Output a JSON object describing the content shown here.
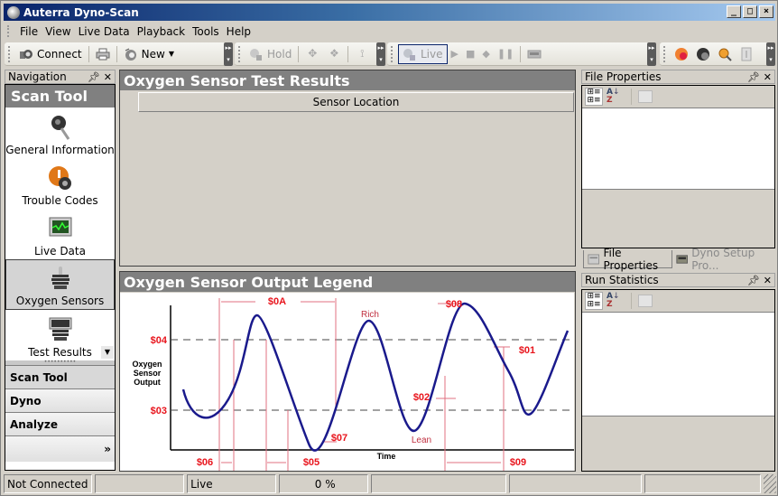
{
  "window": {
    "title": "Auterra Dyno-Scan",
    "controls": [
      "minimize",
      "maximize",
      "close"
    ]
  },
  "menu": {
    "items": [
      "File",
      "View",
      "Live Data",
      "Playback",
      "Tools",
      "Help"
    ]
  },
  "toolbar1": {
    "connect_label": "Connect",
    "new_label": "New",
    "icons": [
      "connect-icon",
      "print-icon",
      "new-icon"
    ]
  },
  "toolbar2": {
    "hold_label": "Hold",
    "icons": [
      "hold-icon",
      "zoom-fit-x-icon",
      "zoom-fit-all-icon",
      "zoom-fit-y-icon"
    ]
  },
  "toolbar3": {
    "live_label": "Live",
    "icons": [
      "live-icon",
      "play-icon",
      "stop-icon",
      "record-icon",
      "pause-icon",
      "meter-icon"
    ]
  },
  "toolbar4": {
    "icons": [
      "red-globe-icon",
      "black-globe-icon",
      "search-icon",
      "document-icon"
    ]
  },
  "navigation": {
    "panel_title": "Navigation",
    "section_title": "Scan Tool",
    "items": [
      {
        "label": "General Information",
        "icon": "key-icon",
        "selected": false
      },
      {
        "label": "Trouble Codes",
        "icon": "warning-tire-icon",
        "selected": false
      },
      {
        "label": "Live Data",
        "icon": "monitor-icon",
        "selected": false
      },
      {
        "label": "Oxygen Sensors",
        "icon": "oxygen-sensor-icon",
        "selected": true
      },
      {
        "label": "Test Results",
        "icon": "test-results-icon",
        "selected": false
      }
    ],
    "sections": [
      {
        "label": "Scan Tool",
        "selected": true
      },
      {
        "label": "Dyno",
        "selected": false
      },
      {
        "label": "Analyze",
        "selected": false
      }
    ],
    "overflow_glyph": "»"
  },
  "test_results": {
    "title": "Oxygen Sensor Test Results",
    "column_header": "Sensor Location"
  },
  "legend_pane": {
    "title": "Oxygen Sensor Output Legend",
    "y_axis_label": [
      "Oxygen",
      "Sensor",
      "Output"
    ],
    "x_axis_label": "Time",
    "threshold_labels": {
      "upper": "$04",
      "lower": "$03"
    },
    "annotations": {
      "a0A": "$0A",
      "a08": "$08",
      "a01": "$01",
      "a02": "$02",
      "a07": "$07",
      "a06": "$06",
      "a05": "$05",
      "a09": "$09",
      "rich": "Rich",
      "lean": "Lean"
    },
    "colors": {
      "curve": "#1a1a8c",
      "annotation": "#e8141c",
      "guide": "#e07080",
      "dash": "#444444"
    }
  },
  "file_properties": {
    "panel_title": "File Properties",
    "toolbar_icons": [
      "categorized-icon",
      "alphabetical-sort-icon",
      "property-pages-icon"
    ]
  },
  "dock_tabs": [
    {
      "label": "File Properties",
      "active": true
    },
    {
      "label": "Dyno Setup Pro...",
      "active": false
    }
  ],
  "run_statistics": {
    "panel_title": "Run Statistics",
    "toolbar_icons": [
      "categorized-icon",
      "alphabetical-sort-icon",
      "property-pages-icon"
    ]
  },
  "statusbar": {
    "connection": "Not Connected",
    "cell2": "",
    "mode": "Live",
    "progress": "0 %",
    "cell5": "",
    "cell6": "",
    "cell7": ""
  }
}
